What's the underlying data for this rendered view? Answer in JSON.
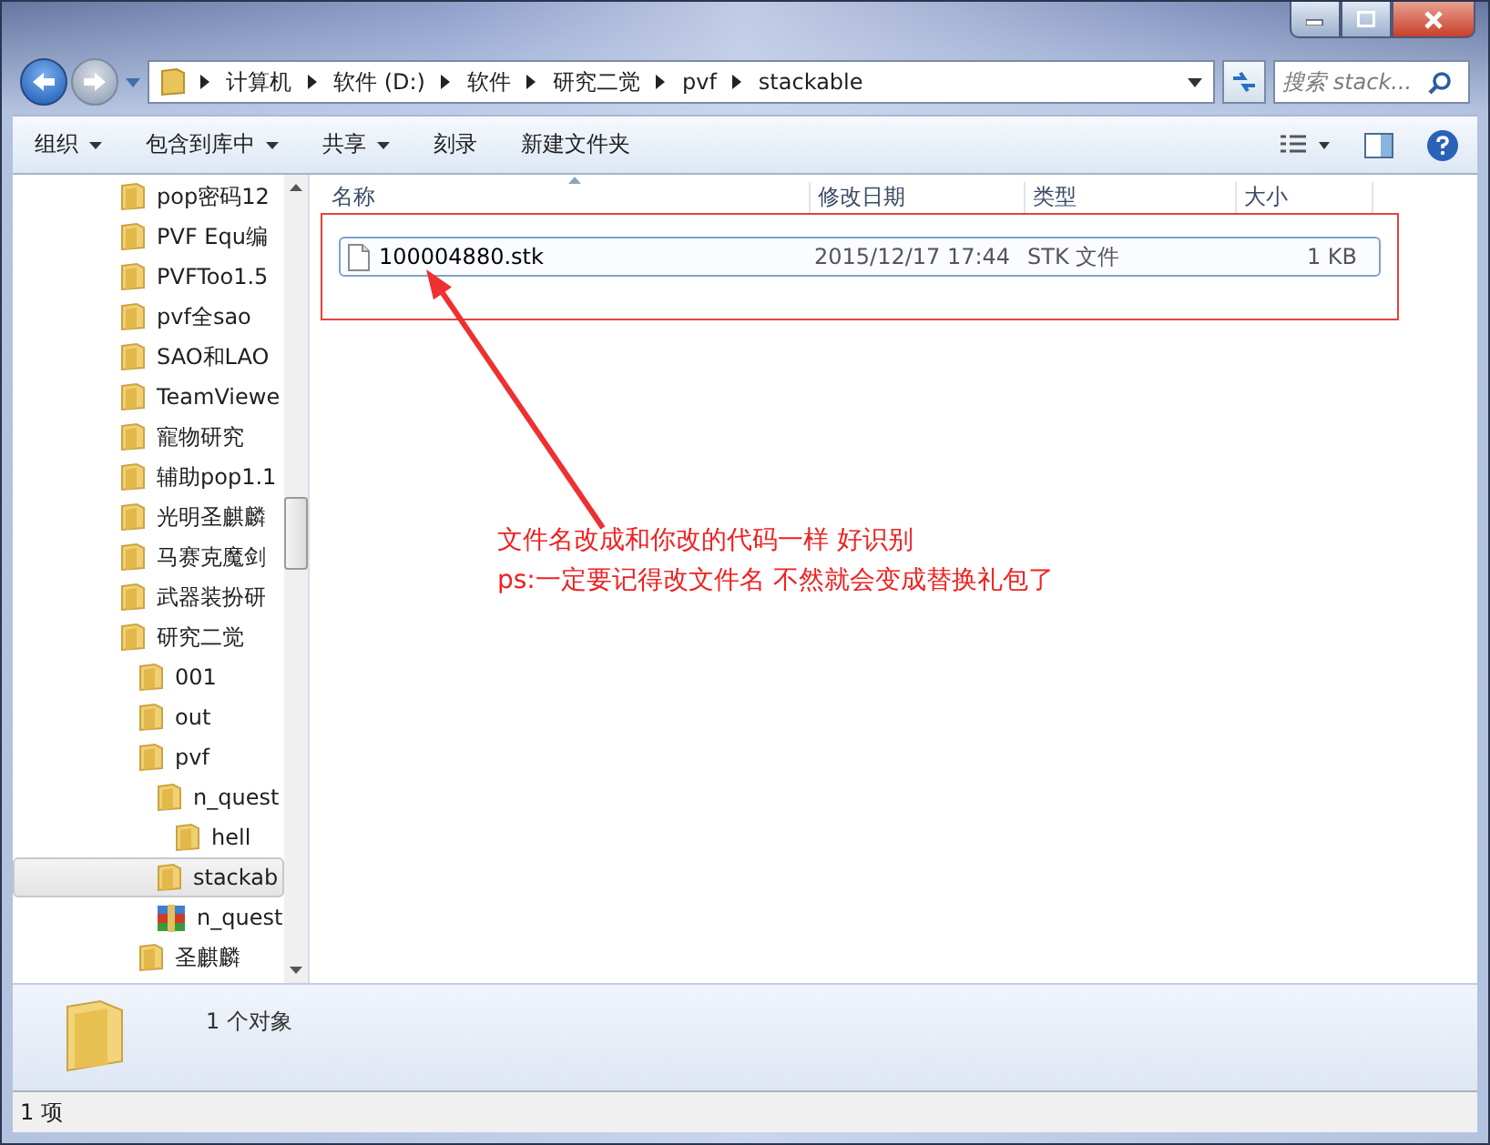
{
  "address_bar": {
    "breadcrumbs": [
      "计算机",
      "软件 (D:)",
      "软件",
      "研究二觉",
      "pvf",
      "stackable"
    ]
  },
  "search": {
    "placeholder": "搜索 stack..."
  },
  "toolbar": {
    "items": [
      {
        "label": "组织",
        "has_menu": true
      },
      {
        "label": "包含到库中",
        "has_menu": true
      },
      {
        "label": "共享",
        "has_menu": true
      },
      {
        "label": "刻录",
        "has_menu": false
      },
      {
        "label": "新建文件夹",
        "has_menu": false
      }
    ]
  },
  "nav_tree": [
    {
      "label": "pop密码12",
      "kind": "folder",
      "selected": false
    },
    {
      "label": "PVF Equ编",
      "kind": "folder",
      "selected": false
    },
    {
      "label": "PVFToo1.5",
      "kind": "folder",
      "selected": false
    },
    {
      "label": "pvf全sao",
      "kind": "folder",
      "selected": false
    },
    {
      "label": "SAO和LAO",
      "kind": "folder",
      "selected": false
    },
    {
      "label": "TeamViewe",
      "kind": "folder",
      "selected": false
    },
    {
      "label": "寵物研究",
      "kind": "folder",
      "selected": false
    },
    {
      "label": "辅助pop1.1",
      "kind": "folder",
      "selected": false
    },
    {
      "label": "光明圣麒麟",
      "kind": "folder",
      "selected": false
    },
    {
      "label": "马赛克魔剑",
      "kind": "folder",
      "selected": false
    },
    {
      "label": "武器装扮研",
      "kind": "folder",
      "selected": false
    },
    {
      "label": "研究二觉",
      "kind": "folder",
      "selected": false,
      "children": [
        {
          "label": "001",
          "kind": "folder",
          "selected": false
        },
        {
          "label": "out",
          "kind": "folder",
          "selected": false
        },
        {
          "label": "pvf",
          "kind": "folder",
          "selected": false,
          "children": [
            {
              "label": "n_quest",
              "kind": "folder",
              "selected": false,
              "children": [
                {
                  "label": "hell",
                  "kind": "folder",
                  "selected": false
                }
              ]
            },
            {
              "label": "stackab",
              "kind": "folder",
              "selected": true
            },
            {
              "label": "n_quest",
              "kind": "archive",
              "selected": false
            }
          ]
        },
        {
          "label": "圣麒麟",
          "kind": "folder",
          "selected": false
        }
      ]
    }
  ],
  "file_list": {
    "columns": [
      "名称",
      "修改日期",
      "类型",
      "大小"
    ],
    "rows": [
      {
        "cells": [
          "100004880.stk",
          "2015/12/17 17:44",
          "STK 文件",
          "1 KB"
        ],
        "selected": true
      }
    ]
  },
  "details": {
    "summary": "1 个对象"
  },
  "status_bar": {
    "text": "1 项"
  },
  "annotation": {
    "lines": [
      "文件名改成和你改的代码一样  好识别",
      "ps:一定要记得改文件名 不然就会变成替换礼包了"
    ]
  }
}
